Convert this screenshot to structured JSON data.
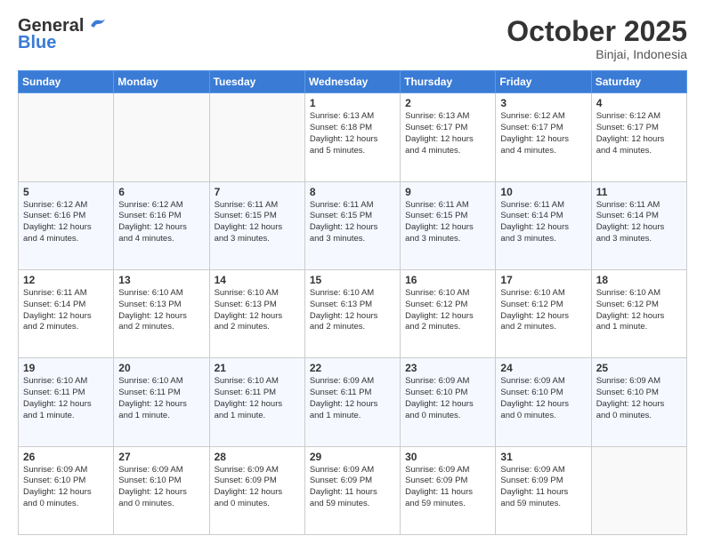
{
  "header": {
    "logo_general": "General",
    "logo_blue": "Blue",
    "month": "October 2025",
    "location": "Binjai, Indonesia"
  },
  "weekdays": [
    "Sunday",
    "Monday",
    "Tuesday",
    "Wednesday",
    "Thursday",
    "Friday",
    "Saturday"
  ],
  "weeks": [
    [
      {
        "day": "",
        "text": ""
      },
      {
        "day": "",
        "text": ""
      },
      {
        "day": "",
        "text": ""
      },
      {
        "day": "1",
        "text": "Sunrise: 6:13 AM\nSunset: 6:18 PM\nDaylight: 12 hours\nand 5 minutes."
      },
      {
        "day": "2",
        "text": "Sunrise: 6:13 AM\nSunset: 6:17 PM\nDaylight: 12 hours\nand 4 minutes."
      },
      {
        "day": "3",
        "text": "Sunrise: 6:12 AM\nSunset: 6:17 PM\nDaylight: 12 hours\nand 4 minutes."
      },
      {
        "day": "4",
        "text": "Sunrise: 6:12 AM\nSunset: 6:17 PM\nDaylight: 12 hours\nand 4 minutes."
      }
    ],
    [
      {
        "day": "5",
        "text": "Sunrise: 6:12 AM\nSunset: 6:16 PM\nDaylight: 12 hours\nand 4 minutes."
      },
      {
        "day": "6",
        "text": "Sunrise: 6:12 AM\nSunset: 6:16 PM\nDaylight: 12 hours\nand 4 minutes."
      },
      {
        "day": "7",
        "text": "Sunrise: 6:11 AM\nSunset: 6:15 PM\nDaylight: 12 hours\nand 3 minutes."
      },
      {
        "day": "8",
        "text": "Sunrise: 6:11 AM\nSunset: 6:15 PM\nDaylight: 12 hours\nand 3 minutes."
      },
      {
        "day": "9",
        "text": "Sunrise: 6:11 AM\nSunset: 6:15 PM\nDaylight: 12 hours\nand 3 minutes."
      },
      {
        "day": "10",
        "text": "Sunrise: 6:11 AM\nSunset: 6:14 PM\nDaylight: 12 hours\nand 3 minutes."
      },
      {
        "day": "11",
        "text": "Sunrise: 6:11 AM\nSunset: 6:14 PM\nDaylight: 12 hours\nand 3 minutes."
      }
    ],
    [
      {
        "day": "12",
        "text": "Sunrise: 6:11 AM\nSunset: 6:14 PM\nDaylight: 12 hours\nand 2 minutes."
      },
      {
        "day": "13",
        "text": "Sunrise: 6:10 AM\nSunset: 6:13 PM\nDaylight: 12 hours\nand 2 minutes."
      },
      {
        "day": "14",
        "text": "Sunrise: 6:10 AM\nSunset: 6:13 PM\nDaylight: 12 hours\nand 2 minutes."
      },
      {
        "day": "15",
        "text": "Sunrise: 6:10 AM\nSunset: 6:13 PM\nDaylight: 12 hours\nand 2 minutes."
      },
      {
        "day": "16",
        "text": "Sunrise: 6:10 AM\nSunset: 6:12 PM\nDaylight: 12 hours\nand 2 minutes."
      },
      {
        "day": "17",
        "text": "Sunrise: 6:10 AM\nSunset: 6:12 PM\nDaylight: 12 hours\nand 2 minutes."
      },
      {
        "day": "18",
        "text": "Sunrise: 6:10 AM\nSunset: 6:12 PM\nDaylight: 12 hours\nand 1 minute."
      }
    ],
    [
      {
        "day": "19",
        "text": "Sunrise: 6:10 AM\nSunset: 6:11 PM\nDaylight: 12 hours\nand 1 minute."
      },
      {
        "day": "20",
        "text": "Sunrise: 6:10 AM\nSunset: 6:11 PM\nDaylight: 12 hours\nand 1 minute."
      },
      {
        "day": "21",
        "text": "Sunrise: 6:10 AM\nSunset: 6:11 PM\nDaylight: 12 hours\nand 1 minute."
      },
      {
        "day": "22",
        "text": "Sunrise: 6:09 AM\nSunset: 6:11 PM\nDaylight: 12 hours\nand 1 minute."
      },
      {
        "day": "23",
        "text": "Sunrise: 6:09 AM\nSunset: 6:10 PM\nDaylight: 12 hours\nand 0 minutes."
      },
      {
        "day": "24",
        "text": "Sunrise: 6:09 AM\nSunset: 6:10 PM\nDaylight: 12 hours\nand 0 minutes."
      },
      {
        "day": "25",
        "text": "Sunrise: 6:09 AM\nSunset: 6:10 PM\nDaylight: 12 hours\nand 0 minutes."
      }
    ],
    [
      {
        "day": "26",
        "text": "Sunrise: 6:09 AM\nSunset: 6:10 PM\nDaylight: 12 hours\nand 0 minutes."
      },
      {
        "day": "27",
        "text": "Sunrise: 6:09 AM\nSunset: 6:10 PM\nDaylight: 12 hours\nand 0 minutes."
      },
      {
        "day": "28",
        "text": "Sunrise: 6:09 AM\nSunset: 6:09 PM\nDaylight: 12 hours\nand 0 minutes."
      },
      {
        "day": "29",
        "text": "Sunrise: 6:09 AM\nSunset: 6:09 PM\nDaylight: 11 hours\nand 59 minutes."
      },
      {
        "day": "30",
        "text": "Sunrise: 6:09 AM\nSunset: 6:09 PM\nDaylight: 11 hours\nand 59 minutes."
      },
      {
        "day": "31",
        "text": "Sunrise: 6:09 AM\nSunset: 6:09 PM\nDaylight: 11 hours\nand 59 minutes."
      },
      {
        "day": "",
        "text": ""
      }
    ]
  ]
}
